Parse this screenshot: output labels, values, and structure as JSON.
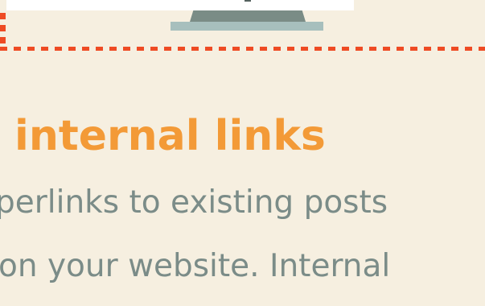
{
  "heading": {
    "text": "internal links",
    "color": "#f39a37"
  },
  "body": {
    "line1": "perlinks to existing posts",
    "line2": "on your website. Internal",
    "color": "#7b8c88"
  },
  "frame": {
    "border_color": "#ee4b24",
    "border_style": "dashed"
  },
  "background_color": "#f6efe0"
}
